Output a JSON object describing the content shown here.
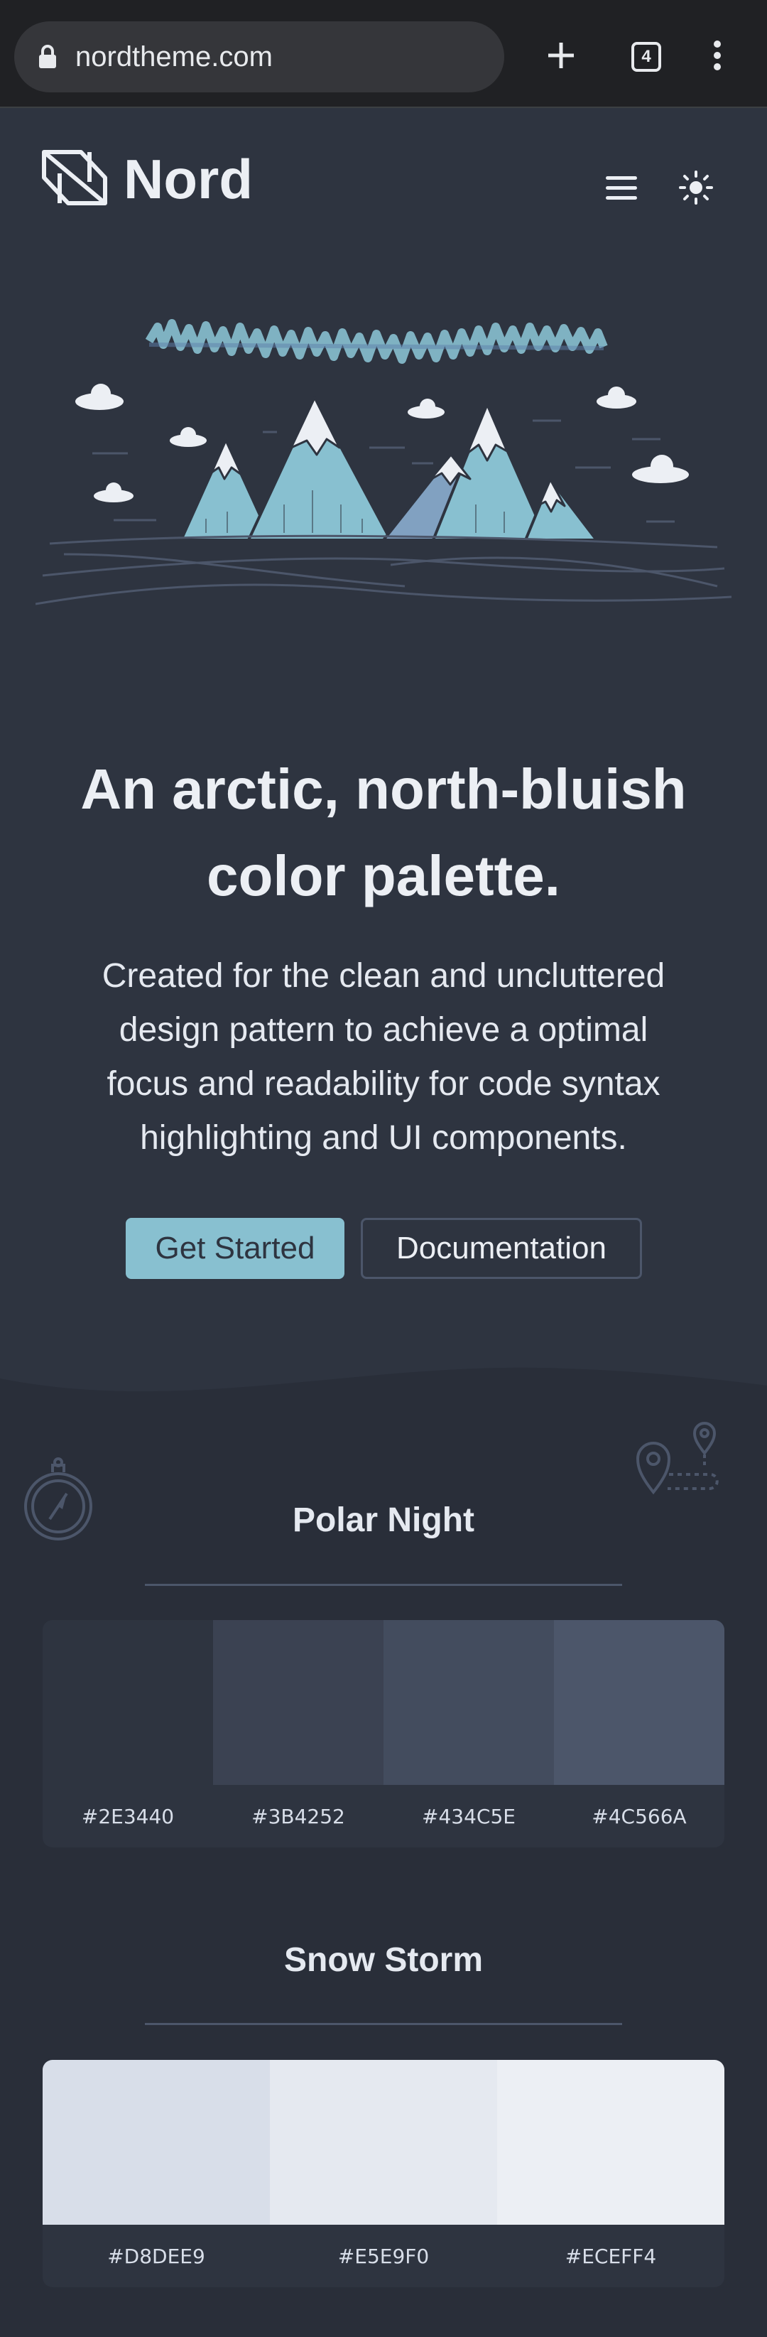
{
  "browser": {
    "url": "nordtheme.com",
    "tab_count": "4",
    "icons": [
      "lock-icon",
      "plus-icon",
      "tabs-icon",
      "kebab-menu-icon"
    ]
  },
  "header": {
    "brand": "Nord",
    "icons": [
      "nord-logo-icon",
      "hamburger-menu-icon",
      "sun-icon"
    ]
  },
  "hero": {
    "title_line1": "An arctic, north-bluish",
    "title_line2": "color palette.",
    "subtitle_line1": "Created for the clean and uncluttered",
    "subtitle_line2": "design pattern to achieve a optimal",
    "subtitle_line3": "focus and readability for code syntax",
    "subtitle_line4": "highlighting and UI components.",
    "primary_button": "Get Started",
    "secondary_button": "Documentation"
  },
  "palettes": {
    "polar_night": {
      "title": "Polar Night",
      "swatches": [
        {
          "hex": "#2E3440",
          "color": "#2e3440"
        },
        {
          "hex": "#3B4252",
          "color": "#3b4252"
        },
        {
          "hex": "#434C5E",
          "color": "#434c5e"
        },
        {
          "hex": "#4C566A",
          "color": "#4c566a"
        }
      ]
    },
    "snow_storm": {
      "title": "Snow Storm",
      "swatches": [
        {
          "hex": "#D8DEE9",
          "color": "#d8dee9"
        },
        {
          "hex": "#E5E9F0",
          "color": "#e5e9f0"
        },
        {
          "hex": "#ECEFF4",
          "color": "#eceff4"
        }
      ]
    }
  },
  "colors": {
    "background": "#2e3440",
    "section_background": "#292e39",
    "accent": "#88c0d0",
    "text": "#eceff4"
  }
}
